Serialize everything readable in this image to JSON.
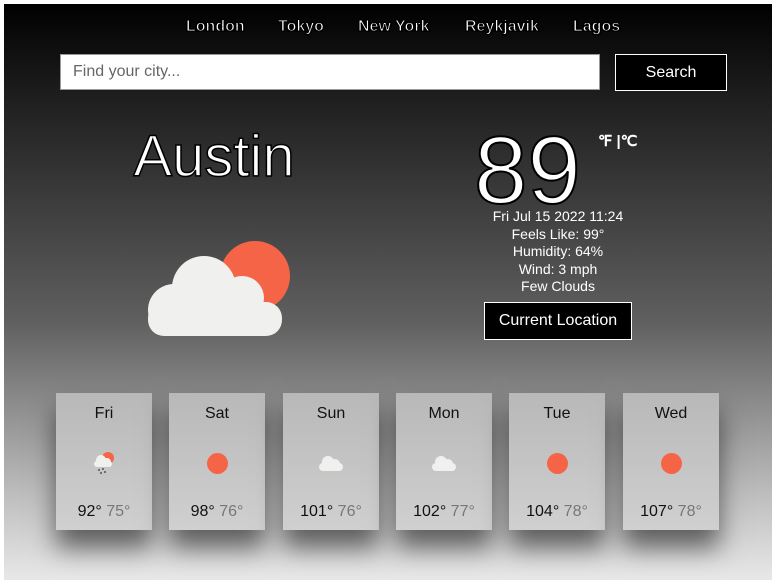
{
  "nav": {
    "cities": [
      "London",
      "Tokyo",
      "New York",
      "Reykjavik",
      "Lagos"
    ]
  },
  "search": {
    "placeholder": "Find your city...",
    "button_label": "Search"
  },
  "current": {
    "city": "Austin",
    "temperature": "89",
    "units_fahrenheit": "℉",
    "units_separator": " |",
    "units_celsius": "℃",
    "datetime": "Fri Jul 15 2022 11:24",
    "feels_like": "Feels Like: 99°",
    "humidity": "Humidity: 64%",
    "wind": "Wind: 3 mph",
    "condition": "Few Clouds",
    "icon": "sun-behind-cloud-icon",
    "location_button_label": "Current Location"
  },
  "forecast": [
    {
      "day": "Fri",
      "icon": "rain-cloud-sun-icon",
      "high": "92°",
      "low": "75°"
    },
    {
      "day": "Sat",
      "icon": "sun-icon",
      "high": "98°",
      "low": "76°"
    },
    {
      "day": "Sun",
      "icon": "cloud-icon",
      "high": "101°",
      "low": "76°"
    },
    {
      "day": "Mon",
      "icon": "cloud-icon",
      "high": "102°",
      "low": "77°"
    },
    {
      "day": "Tue",
      "icon": "sun-icon",
      "high": "104°",
      "low": "78°"
    },
    {
      "day": "Wed",
      "icon": "sun-icon",
      "high": "107°",
      "low": "78°"
    }
  ],
  "colors": {
    "sun": "#f56447",
    "cloud": "#f0f0ee",
    "button_bg": "#000000"
  }
}
